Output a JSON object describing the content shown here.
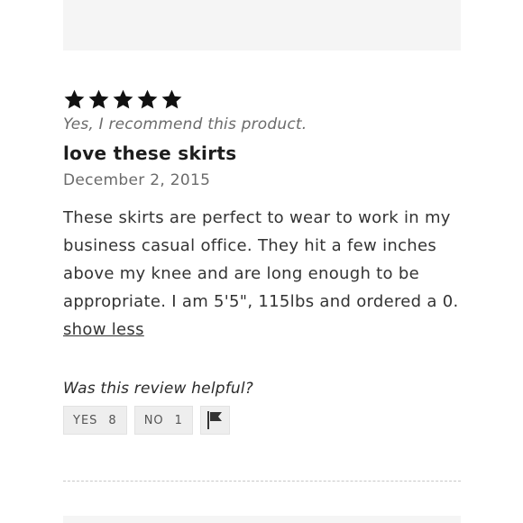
{
  "review": {
    "rating": 5,
    "rating_max": 5,
    "recommend_text": "Yes, I recommend this product.",
    "title": "love these skirts",
    "date": "December 2, 2015",
    "body": "These skirts are perfect to wear to work in my business casual office. They hit a few inches above my knee and are long enough to be appropriate. I am 5'5\", 115lbs and ordered a 0. ",
    "show_less_label": "show less"
  },
  "helpful": {
    "question": "Was this review helpful?",
    "yes_label": "YES",
    "yes_count": "8",
    "no_label": "NO",
    "no_count": "1"
  },
  "icons": {
    "star": "star-icon",
    "flag": "flag-icon"
  },
  "colors": {
    "star": "#111111",
    "button_bg": "#eeeeee",
    "muted_text": "#6b6b6b"
  }
}
